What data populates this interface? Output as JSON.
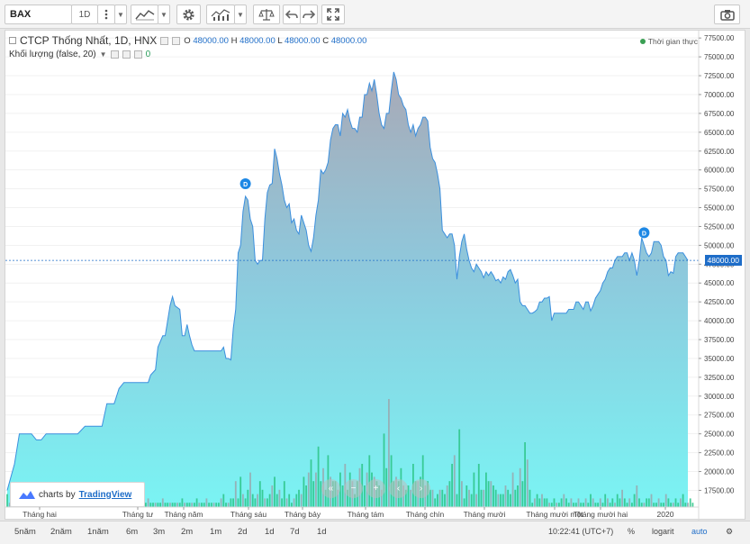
{
  "toolbar": {
    "symbol": "BAX",
    "interval": "1D",
    "icons": [
      "more-vertical-icon",
      "chart-style-icon",
      "settings-gear-icon",
      "indicators-icon",
      "compare-scale-icon",
      "undo-icon",
      "redo-icon",
      "fullscreen-icon",
      "camera-icon"
    ]
  },
  "legend": {
    "title": "CTCP Thống Nhất, 1D, HNX",
    "o_label": "O",
    "o_value": "48000.00",
    "h_label": "H",
    "h_value": "48000.00",
    "l_label": "L",
    "l_value": "48000.00",
    "c_label": "C",
    "c_value": "48000.00",
    "volume_label": "Khối lượng (false, 20)",
    "volume_value": "0",
    "realtime": "Thời gian thực"
  },
  "current_price": "48000.00",
  "branding": {
    "prefix": "charts by",
    "name": "TradingView"
  },
  "chart_data": {
    "type": "area",
    "price_axis_ticks": [
      "77500.00",
      "75000.00",
      "72500.00",
      "70000.00",
      "67500.00",
      "65000.00",
      "62500.00",
      "60000.00",
      "57500.00",
      "55000.00",
      "52500.00",
      "50000.00",
      "47500.00",
      "45000.00",
      "42500.00",
      "40000.00",
      "37500.00",
      "35000.00",
      "32500.00",
      "30000.00",
      "27500.00",
      "25000.00",
      "22500.00",
      "20000.00",
      "17500.00"
    ],
    "time_axis_ticks": [
      "Tháng hai",
      "Tháng tư",
      "Tháng năm",
      "Tháng sáu",
      "Tháng bảy",
      "Tháng tám",
      "Tháng chín",
      "Tháng mười",
      "Tháng mười một",
      "Tháng mười hai",
      "2020"
    ],
    "ylim": [
      16000,
      78000
    ],
    "price_series": [
      [
        0,
        17500
      ],
      [
        3,
        21000
      ],
      [
        5,
        25000
      ],
      [
        8,
        25000
      ],
      [
        10,
        25000
      ],
      [
        12,
        24200
      ],
      [
        14,
        24200
      ],
      [
        16,
        25000
      ],
      [
        19,
        25000
      ],
      [
        22,
        25000
      ],
      [
        25,
        25000
      ],
      [
        29,
        25000
      ],
      [
        32,
        26000
      ],
      [
        35,
        26000
      ],
      [
        37,
        26000
      ],
      [
        39,
        26000
      ],
      [
        41,
        29000
      ],
      [
        44,
        29000
      ],
      [
        46,
        31000
      ],
      [
        48,
        31800
      ],
      [
        50,
        31800
      ],
      [
        53,
        31800
      ],
      [
        56,
        31800
      ],
      [
        58,
        31800
      ],
      [
        59,
        32800
      ],
      [
        61,
        33500
      ],
      [
        62,
        36500
      ],
      [
        64,
        38000
      ],
      [
        65,
        38000
      ],
      [
        67,
        42000
      ],
      [
        68,
        43200
      ],
      [
        69,
        42000
      ],
      [
        71,
        41500
      ],
      [
        72,
        38000
      ],
      [
        73,
        38000
      ],
      [
        74,
        39500
      ],
      [
        75,
        38000
      ],
      [
        76,
        36800
      ],
      [
        77,
        36000
      ],
      [
        79,
        36000
      ],
      [
        82,
        36000
      ],
      [
        85,
        36000
      ],
      [
        88,
        36000
      ],
      [
        89,
        36500
      ],
      [
        90,
        35000
      ],
      [
        91,
        35000
      ],
      [
        92,
        34800
      ],
      [
        93,
        39000
      ],
      [
        94,
        41500
      ],
      [
        95,
        49000
      ],
      [
        96,
        50000
      ],
      [
        97,
        54500
      ],
      [
        98,
        56500
      ],
      [
        99,
        56000
      ],
      [
        100,
        53500
      ],
      [
        101,
        52500
      ],
      [
        102,
        48000
      ],
      [
        103,
        47500
      ],
      [
        104,
        48000
      ],
      [
        105,
        48000
      ],
      [
        106,
        53500
      ],
      [
        107,
        57000
      ],
      [
        108,
        58000
      ],
      [
        109,
        58200
      ],
      [
        110,
        62800
      ],
      [
        111,
        61500
      ],
      [
        112,
        59500
      ],
      [
        113,
        58000
      ],
      [
        114,
        56000
      ],
      [
        115,
        55000
      ],
      [
        116,
        55500
      ],
      [
        117,
        53000
      ],
      [
        118,
        53500
      ],
      [
        119,
        52000
      ],
      [
        120,
        51500
      ],
      [
        121,
        54000
      ],
      [
        122,
        53000
      ],
      [
        123,
        52000
      ],
      [
        124,
        50000
      ],
      [
        125,
        49200
      ],
      [
        126,
        51000
      ],
      [
        127,
        54000
      ],
      [
        128,
        56000
      ],
      [
        129,
        60000
      ],
      [
        130,
        59500
      ],
      [
        131,
        60000
      ],
      [
        132,
        61000
      ],
      [
        133,
        64000
      ],
      [
        134,
        65500
      ],
      [
        135,
        66000
      ],
      [
        136,
        66000
      ],
      [
        137,
        64500
      ],
      [
        138,
        67500
      ],
      [
        139,
        67000
      ],
      [
        140,
        68000
      ],
      [
        141,
        66500
      ],
      [
        142,
        65500
      ],
      [
        143,
        65500
      ],
      [
        144,
        65000
      ],
      [
        145,
        67000
      ],
      [
        146,
        67000
      ],
      [
        147,
        70000
      ],
      [
        148,
        70000
      ],
      [
        149,
        71500
      ],
      [
        150,
        70500
      ],
      [
        151,
        72000
      ],
      [
        152,
        70000
      ],
      [
        153,
        67500
      ],
      [
        154,
        66000
      ],
      [
        155,
        65500
      ],
      [
        156,
        67500
      ],
      [
        157,
        67500
      ],
      [
        158,
        70500
      ],
      [
        159,
        73000
      ],
      [
        160,
        72000
      ],
      [
        161,
        70000
      ],
      [
        162,
        69500
      ],
      [
        163,
        68500
      ],
      [
        164,
        68000
      ],
      [
        165,
        66000
      ],
      [
        166,
        65000
      ],
      [
        167,
        66000
      ],
      [
        168,
        64500
      ],
      [
        169,
        65500
      ],
      [
        170,
        66000
      ],
      [
        171,
        67000
      ],
      [
        172,
        67000
      ],
      [
        173,
        66500
      ],
      [
        174,
        63000
      ],
      [
        175,
        61500
      ],
      [
        176,
        61000
      ],
      [
        177,
        59500
      ],
      [
        178,
        57500
      ],
      [
        179,
        52000
      ],
      [
        180,
        51500
      ],
      [
        181,
        51000
      ],
      [
        182,
        51500
      ],
      [
        183,
        51500
      ],
      [
        184,
        50000
      ],
      [
        185,
        45500
      ],
      [
        186,
        48500
      ],
      [
        187,
        50500
      ],
      [
        188,
        51500
      ],
      [
        189,
        49500
      ],
      [
        190,
        48000
      ],
      [
        191,
        47000
      ],
      [
        192,
        46500
      ],
      [
        193,
        47500
      ],
      [
        194,
        47000
      ],
      [
        195,
        46500
      ],
      [
        196,
        45700
      ],
      [
        197,
        46500
      ],
      [
        198,
        46000
      ],
      [
        199,
        46500
      ],
      [
        200,
        46000
      ],
      [
        201,
        45300
      ],
      [
        202,
        45500
      ],
      [
        203,
        45000
      ],
      [
        204,
        45800
      ],
      [
        205,
        45500
      ],
      [
        206,
        46500
      ],
      [
        207,
        46800
      ],
      [
        208,
        46000
      ],
      [
        209,
        45000
      ],
      [
        210,
        45500
      ],
      [
        211,
        42500
      ],
      [
        212,
        42000
      ],
      [
        213,
        42000
      ],
      [
        214,
        41500
      ],
      [
        215,
        41000
      ],
      [
        216,
        41000
      ],
      [
        217,
        41200
      ],
      [
        218,
        41500
      ],
      [
        219,
        42500
      ],
      [
        220,
        42500
      ],
      [
        221,
        43000
      ],
      [
        222,
        43000
      ],
      [
        223,
        43200
      ],
      [
        224,
        40000
      ],
      [
        225,
        41000
      ],
      [
        226,
        41000
      ],
      [
        227,
        41000
      ],
      [
        228,
        41000
      ],
      [
        229,
        41000
      ],
      [
        230,
        41000
      ],
      [
        231,
        41500
      ],
      [
        232,
        41500
      ],
      [
        233,
        41500
      ],
      [
        234,
        42500
      ],
      [
        235,
        42500
      ],
      [
        236,
        42000
      ],
      [
        237,
        41500
      ],
      [
        238,
        42500
      ],
      [
        239,
        42500
      ],
      [
        240,
        41300
      ],
      [
        241,
        42000
      ],
      [
        242,
        43000
      ],
      [
        243,
        43500
      ],
      [
        244,
        44000
      ],
      [
        245,
        45000
      ],
      [
        246,
        45500
      ],
      [
        247,
        46500
      ],
      [
        248,
        47000
      ],
      [
        249,
        47000
      ],
      [
        250,
        48000
      ],
      [
        251,
        48500
      ],
      [
        252,
        48500
      ],
      [
        253,
        48500
      ],
      [
        254,
        49000
      ],
      [
        255,
        49000
      ],
      [
        256,
        48000
      ],
      [
        257,
        49000
      ],
      [
        258,
        48000
      ],
      [
        259,
        46000
      ],
      [
        260,
        48000
      ],
      [
        261,
        51000
      ],
      [
        262,
        50000
      ],
      [
        263,
        49000
      ],
      [
        264,
        48500
      ],
      [
        265,
        49000
      ],
      [
        266,
        50500
      ],
      [
        267,
        50500
      ],
      [
        268,
        50500
      ],
      [
        269,
        50000
      ],
      [
        270,
        48500
      ],
      [
        271,
        48000
      ],
      [
        272,
        46000
      ],
      [
        273,
        46500
      ],
      [
        274,
        46300
      ],
      [
        275,
        48500
      ],
      [
        276,
        49000
      ],
      [
        277,
        49000
      ],
      [
        278,
        49000
      ],
      [
        279,
        48500
      ],
      [
        280,
        48000
      ]
    ],
    "volume_bars": [
      3,
      1,
      1,
      1,
      2,
      1,
      1,
      1,
      2,
      1,
      1,
      1,
      1,
      1,
      2,
      1,
      1,
      1,
      1,
      1,
      1,
      1,
      1,
      1,
      1,
      1,
      1,
      1,
      1,
      1,
      1,
      1,
      1,
      1,
      1,
      1,
      1,
      1,
      1,
      1,
      1,
      1,
      1,
      1,
      1,
      1,
      1,
      1,
      1,
      1,
      1,
      1,
      1,
      1,
      1,
      1,
      1,
      1,
      2,
      1,
      1,
      1,
      1,
      1,
      2,
      1,
      1,
      1,
      1,
      1,
      1,
      1,
      2,
      1,
      1,
      1,
      1,
      1,
      2,
      1,
      1,
      1,
      2,
      1,
      1,
      1,
      1,
      1,
      2,
      3,
      1,
      1,
      2,
      2,
      6,
      2,
      7,
      3,
      2,
      4,
      8,
      3,
      2,
      3,
      6,
      4,
      2,
      2,
      3,
      5,
      7,
      3,
      4,
      2,
      6,
      2,
      3,
      1,
      2,
      3,
      4,
      3,
      7,
      5,
      8,
      11,
      6,
      8,
      14,
      6,
      9,
      4,
      12,
      7,
      6,
      6,
      4,
      8,
      5,
      10,
      4,
      8,
      6,
      3,
      6,
      9,
      10,
      5,
      8,
      12,
      8,
      7,
      6,
      5,
      4,
      17,
      9,
      25,
      12,
      6,
      7,
      6,
      9,
      5,
      4,
      5,
      4,
      10,
      6,
      6,
      7,
      12,
      5,
      6,
      4,
      4,
      2,
      3,
      4,
      4,
      3,
      5,
      6,
      10,
      12,
      3,
      18,
      6,
      2,
      5,
      4,
      3,
      8,
      3,
      10,
      4,
      4,
      8,
      6,
      6,
      5,
      4,
      3,
      3,
      3,
      5,
      4,
      3,
      8,
      4,
      5,
      9,
      6,
      15,
      11,
      4,
      1,
      2,
      3,
      2,
      3,
      2,
      2,
      1,
      1,
      2,
      1,
      1,
      2,
      3,
      2,
      1,
      2,
      1,
      1,
      2,
      1,
      1,
      2,
      1,
      3,
      2,
      1,
      1,
      2,
      1,
      3,
      2,
      1,
      2,
      1,
      3,
      2,
      4,
      2,
      1,
      2,
      1,
      3,
      5,
      2,
      1,
      1,
      2,
      2,
      3,
      1,
      1,
      2,
      1,
      1,
      3,
      2,
      1,
      1,
      2,
      1,
      2,
      3,
      1,
      1,
      2,
      1
    ],
    "dividend_markers": [
      98,
      262
    ]
  },
  "bottom_bar": {
    "ranges": [
      "5năm",
      "2năm",
      "1năm",
      "6m",
      "3m",
      "2m",
      "1m",
      "2d",
      "1d",
      "7d",
      "1d"
    ],
    "time": "10:22:41 (UTC+7)",
    "percent": "%",
    "log": "logarit",
    "auto": "auto"
  }
}
